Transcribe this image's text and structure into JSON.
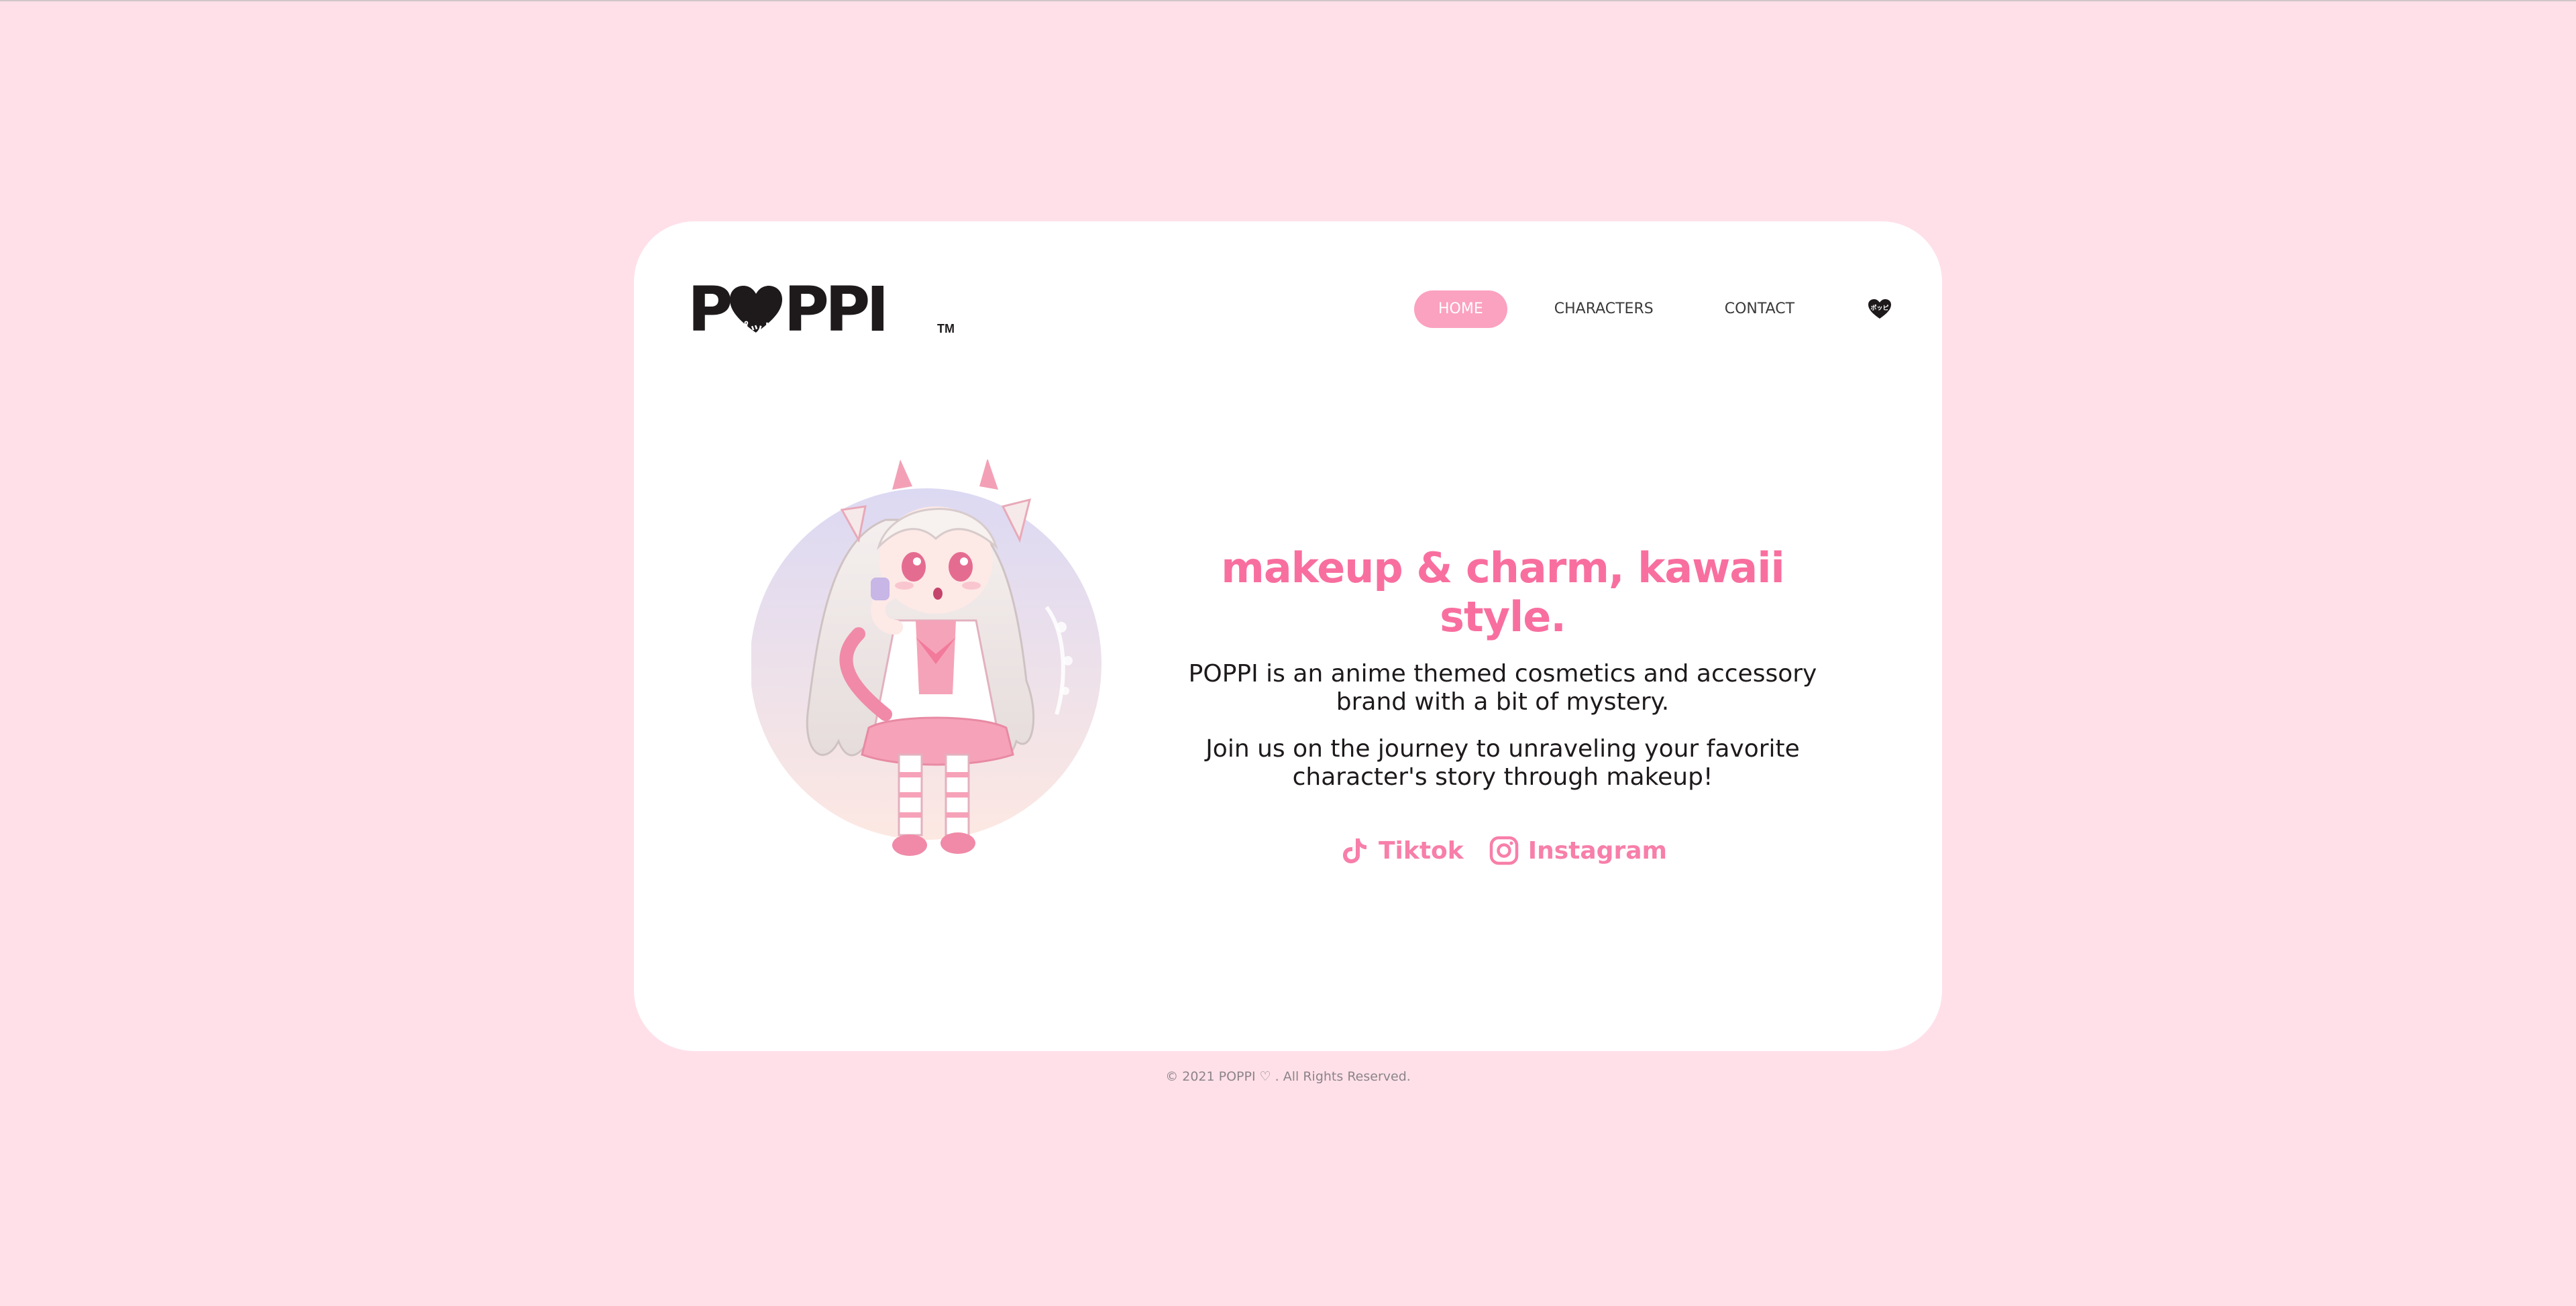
{
  "brand": {
    "logo_prefix": "P",
    "logo_heart_text": "ポッピ",
    "logo_suffix": "PPI",
    "trademark": "TM",
    "nav_heart_text": "ポッピ"
  },
  "nav": {
    "items": [
      {
        "label": "HOME",
        "active": true
      },
      {
        "label": "CHARACTERS",
        "active": false
      },
      {
        "label": "CONTACT",
        "active": false
      }
    ]
  },
  "hero": {
    "headline": "makeup & charm, kawaii style.",
    "paragraph_1": "POPPI is an anime themed cosmetics and accessory brand with a bit of mystery.",
    "paragraph_2": "Join us on the journey to unraveling your favorite character's story through makeup!",
    "socials": [
      {
        "label": "Tiktok",
        "icon": "tiktok-icon"
      },
      {
        "label": "Instagram",
        "icon": "instagram-icon"
      }
    ]
  },
  "footer": {
    "copyright": "© 2021 POPPI ♡ . All Rights Reserved."
  },
  "colors": {
    "page_background": "#ffe0e9",
    "card_background": "#ffffff",
    "accent_pink": "#f86f9f",
    "nav_active": "#fba2c0",
    "text_dark": "#1e1a1b"
  }
}
